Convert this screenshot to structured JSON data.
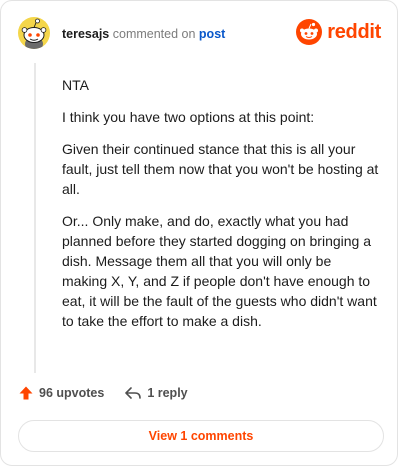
{
  "header": {
    "username": "teresajs",
    "action_text": "commented on",
    "post_link": "post",
    "brand_name": "reddit"
  },
  "comment": {
    "paragraphs": [
      "NTA",
      "I think you have two options at this point:",
      "Given their continued stance that this is all your fault, just tell them now that you won't be hosting at all.",
      "Or... Only make, and do, exactly what you had planned before they started dogging on bringing a dish. Message them all that you will only be making X, Y, and Z if people don't have enough to eat, it will be the fault of the guests who didn't want to take the effort to make a dish."
    ]
  },
  "actions": {
    "upvotes": "96 upvotes",
    "reply": "1 reply"
  },
  "footer": {
    "view_label": "View 1 comments"
  },
  "colors": {
    "brand": "#ff4500",
    "link": "#0a58ca",
    "avatar_bg": "#f4d64a"
  },
  "icons": [
    "snoo-avatar-icon",
    "reddit-logo-icon",
    "upvote-arrow-icon",
    "reply-arrow-icon"
  ]
}
